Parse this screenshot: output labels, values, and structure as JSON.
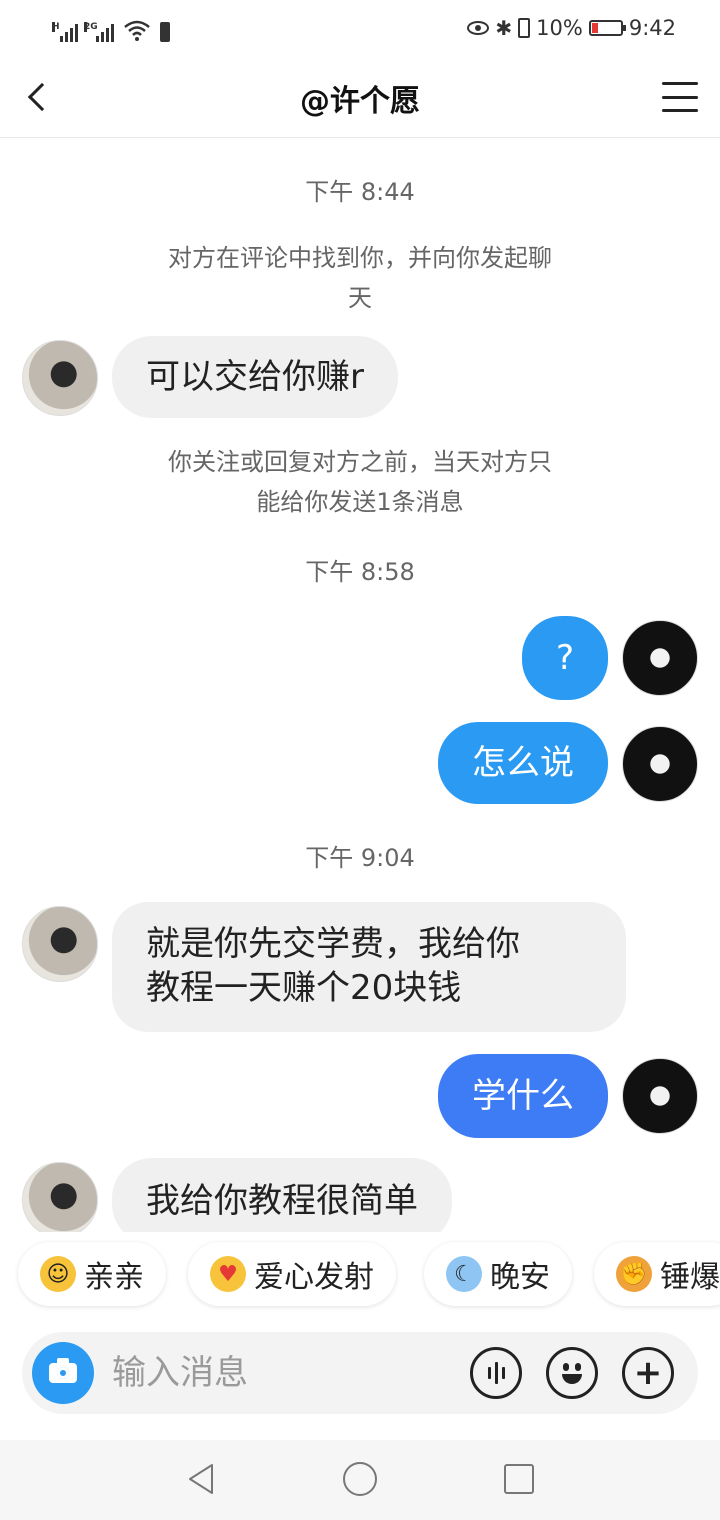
{
  "status_bar": {
    "signal1_label": "H",
    "signal2_label": "2G",
    "battery_percent": "10%",
    "time": "9:42"
  },
  "header": {
    "title": "@许个愿"
  },
  "chat": {
    "time1": "下午 8:44",
    "system1": "对方在评论中找到你，并向你发起聊天",
    "msg1": "可以交给你赚r",
    "system2": "你关注或回复对方之前，当天对方只能给你发送1条消息",
    "time2": "下午 8:58",
    "msg2": "?",
    "msg3": "怎么说",
    "time3": "下午 9:04",
    "msg4_line1": "就是你先交学费，我给你",
    "msg4_line2": "教程一天赚个20块钱",
    "msg5": "学什么",
    "msg6": "我给你教程很简单"
  },
  "stickers": [
    {
      "label": "亲亲",
      "icon": "hug-emoji"
    },
    {
      "label": "爱心发射",
      "icon": "heart-eyes-emoji"
    },
    {
      "label": "晚安",
      "icon": "sleep-emoji"
    },
    {
      "label": "锤爆",
      "icon": "hammer-emoji"
    }
  ],
  "input": {
    "placeholder": "输入消息"
  },
  "colors": {
    "bubble_blue": "#2b9af3",
    "bubble_blue_alt": "#3d7cf5",
    "bubble_gray": "#f0f0f0",
    "camera_blue": "#2b9af3"
  }
}
